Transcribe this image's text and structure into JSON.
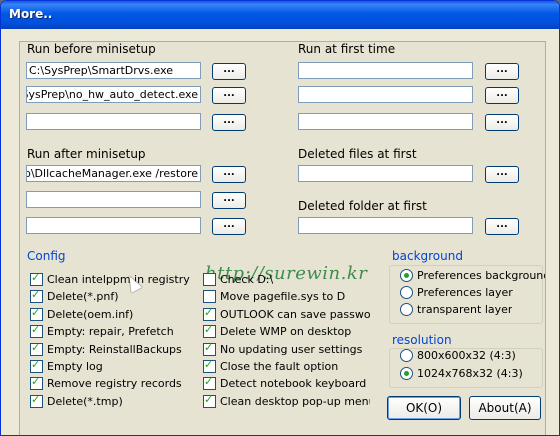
{
  "window": {
    "title": "More.."
  },
  "run_before": {
    "label": "Run before minisetup",
    "fields": [
      "C:\\SysPrep\\SmartDrvs.exe",
      "\\SysPrep\\no_hw_auto_detect.exe",
      ""
    ],
    "browse": "..."
  },
  "run_after": {
    "label": "Run after minisetup",
    "fields": [
      "\\SysPrep\\DllcacheManager.exe /restore",
      "",
      ""
    ],
    "browse": "..."
  },
  "run_first": {
    "label": "Run at first time",
    "fields": [
      "",
      "",
      ""
    ],
    "browse": "..."
  },
  "deleted_files": {
    "label": "Deleted files at first",
    "field": "",
    "browse": "..."
  },
  "deleted_folder": {
    "label": "Deleted folder at first",
    "field": "",
    "browse": "..."
  },
  "watermark": "http://surewin.kr",
  "config": {
    "label": "Config",
    "left": [
      {
        "label": "Clean intelppm in registry",
        "checked": true
      },
      {
        "label": "Delete(*.pnf)",
        "checked": true
      },
      {
        "label": "Delete(oem.inf)",
        "checked": true
      },
      {
        "label": "Empty: repair,  Prefetch",
        "checked": true
      },
      {
        "label": "Empty: ReinstallBackups",
        "checked": true
      },
      {
        "label": "Empty log",
        "checked": true
      },
      {
        "label": "Remove registry records",
        "checked": true
      },
      {
        "label": "Delete(*.tmp)",
        "checked": true
      }
    ],
    "right": [
      {
        "label": "Check D:\\",
        "checked": false
      },
      {
        "label": "Move pagefile.sys to D",
        "checked": false
      },
      {
        "label": "OUTLOOK can save passwords",
        "checked": true
      },
      {
        "label": "Delete WMP on desktop",
        "checked": true
      },
      {
        "label": "No updating user settings",
        "checked": true
      },
      {
        "label": "Close the fault option",
        "checked": true
      },
      {
        "label": "Detect notebook keyboard",
        "checked": true
      },
      {
        "label": "Clean desktop pop-up menu",
        "checked": true
      }
    ]
  },
  "background": {
    "label": "background",
    "options": [
      {
        "label": "Preferences background",
        "selected": true
      },
      {
        "label": "Preferences layer",
        "selected": false
      },
      {
        "label": "transparent layer",
        "selected": false
      }
    ]
  },
  "resolution": {
    "label": "resolution",
    "options": [
      {
        "label": "800x600x32  (4:3)",
        "selected": false
      },
      {
        "label": "1024x768x32 (4:3)",
        "selected": true
      }
    ]
  },
  "buttons": {
    "ok": "OK(O)",
    "about": "About(A)"
  }
}
